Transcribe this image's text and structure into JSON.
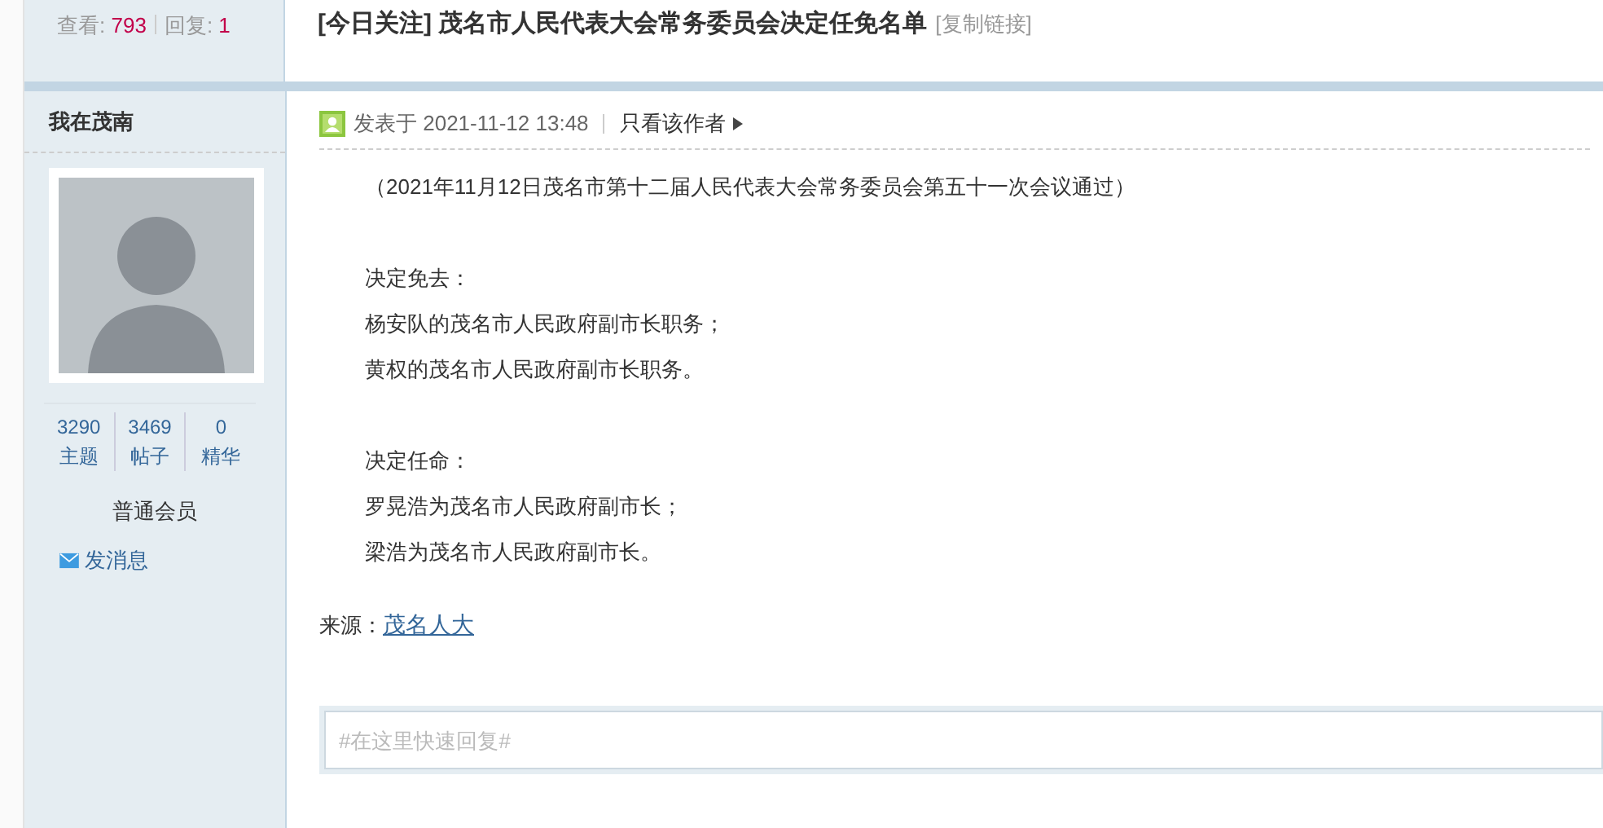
{
  "thread_stats": {
    "views_label": "查看:",
    "views": "793",
    "replies_label": "回复:",
    "replies": "1"
  },
  "thread_title": {
    "tag": "[今日关注]",
    "title": "茂名市人民代表大会常务委员会决定任免名单",
    "copy_link": "[复制链接]"
  },
  "author": {
    "name": "我在茂南",
    "stats": [
      {
        "value": "3290",
        "label": "主题"
      },
      {
        "value": "3469",
        "label": "帖子"
      },
      {
        "value": "0",
        "label": "精华"
      }
    ],
    "group": "普通会员",
    "message_link": "发消息"
  },
  "post": {
    "posted_at": "发表于 2021-11-12 13:48",
    "author_only_link": "只看该作者",
    "blocks": [
      {
        "lines": [
          "（2021年11月12日茂名市第十二届人民代表大会常务委员会第五十一次会议通过）"
        ]
      },
      {
        "lines": [
          "决定免去：",
          "杨安队的茂名市人民政府副市长职务；",
          "黄权的茂名市人民政府副市长职务。"
        ]
      },
      {
        "lines": [
          "决定任命：",
          "罗晃浩为茂名市人民政府副市长；",
          "梁浩为茂名市人民政府副市长。"
        ]
      }
    ],
    "source_label": "来源：",
    "source_link": "茂名人大"
  },
  "quick_reply": {
    "placeholder": "#在这里快速回复#"
  }
}
